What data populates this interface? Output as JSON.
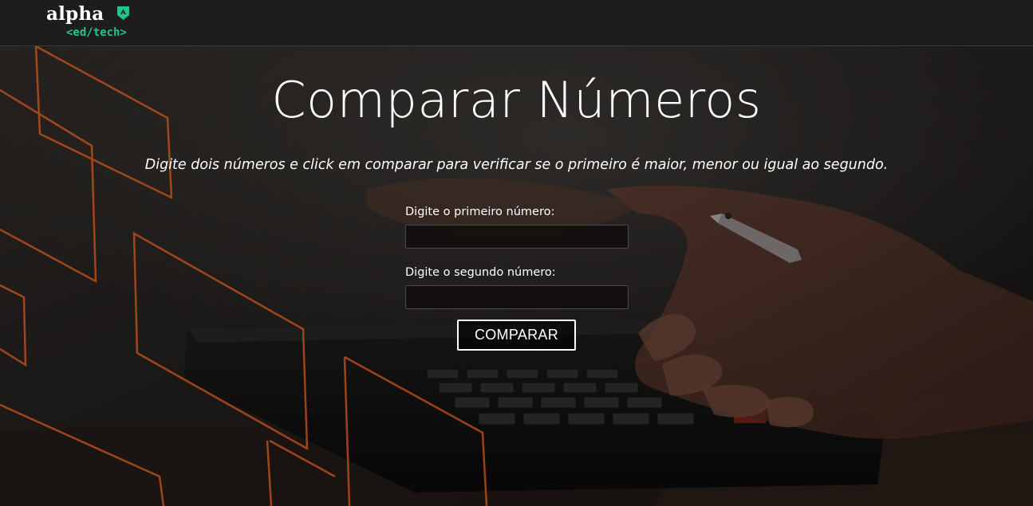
{
  "navbar": {
    "logo_word": "alpha",
    "logo_sub": "<ed/tech>",
    "logo_icon": "alpha-triangle-icon"
  },
  "hero": {
    "title": "Comparar Números",
    "subtitle": "Digite dois números e click em comparar para verificar se o primeiro é maior, menor ou igual ao segundo.",
    "background": "calculator-hands-photo"
  },
  "form": {
    "first_label": "Digite o primeiro número:",
    "first_value": "",
    "second_label": "Digite o segundo número:",
    "second_value": "",
    "button_label": "COMPARAR"
  },
  "colors": {
    "navbar_bg": "#1d1d1d",
    "accent_green": "#1fc58a",
    "decor_orange": "#c2501c",
    "text": "#ffffff"
  }
}
